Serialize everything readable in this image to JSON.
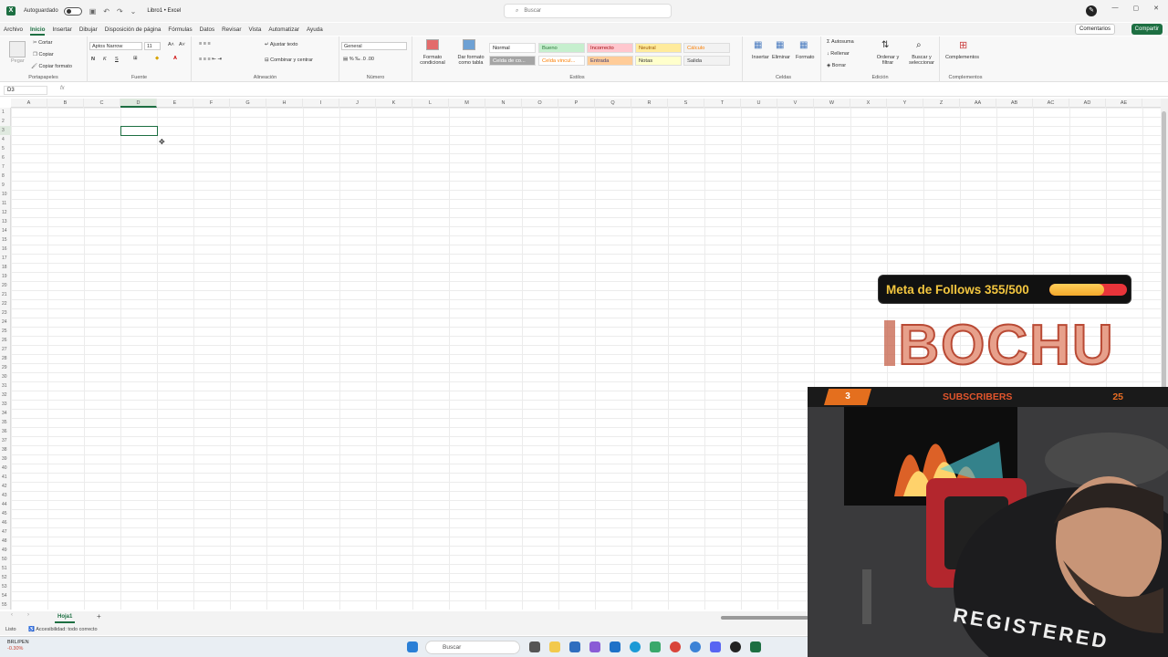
{
  "titlebar": {
    "autosave_label": "Autoguardado",
    "doc_title": "Libro1 • Excel",
    "search_placeholder": "Buscar"
  },
  "menu": {
    "tabs": [
      "Archivo",
      "Inicio",
      "Insertar",
      "Dibujar",
      "Disposición de página",
      "Fórmulas",
      "Datos",
      "Revisar",
      "Vista",
      "Automatizar",
      "Ayuda"
    ],
    "active_tab": "Inicio",
    "comments": "Comentarios",
    "share": "Compartir"
  },
  "ribbon": {
    "clipboard": {
      "paste": "Pegar",
      "cut": "Cortar",
      "copy": "Copiar",
      "format_painter": "Copiar formato",
      "label": "Portapapeles"
    },
    "font": {
      "name": "Aptos Narrow",
      "size": "11",
      "bold": "N",
      "italic": "K",
      "underline": "S",
      "label": "Fuente"
    },
    "alignment": {
      "wrap": "Ajustar texto",
      "merge": "Combinar y centrar",
      "label": "Alineación"
    },
    "number": {
      "format": "General",
      "label": "Número"
    },
    "styles": {
      "conditional": "Formato condicional",
      "as_table": "Dar formato como tabla",
      "cells": [
        {
          "text": "Normal",
          "bg": "#ffffff",
          "fg": "#222222"
        },
        {
          "text": "Bueno",
          "bg": "#c6efce",
          "fg": "#2c7a3b"
        },
        {
          "text": "Incorrecto",
          "bg": "#ffc7ce",
          "fg": "#9c0006"
        },
        {
          "text": "Neutral",
          "bg": "#ffeb9c",
          "fg": "#9c5700"
        },
        {
          "text": "Cálculo",
          "bg": "#f2f2f2",
          "fg": "#fa7d00"
        },
        {
          "text": "Celda de co...",
          "bg": "#a5a5a5",
          "fg": "#ffffff"
        },
        {
          "text": "Celda vincul...",
          "bg": "#ffffff",
          "fg": "#fa7d00"
        },
        {
          "text": "Entrada",
          "bg": "#ffcc99",
          "fg": "#3f3f76"
        },
        {
          "text": "Notas",
          "bg": "#ffffcc",
          "fg": "#333333"
        },
        {
          "text": "Salida",
          "bg": "#f2f2f2",
          "fg": "#3f3f3f"
        }
      ],
      "label": "Estilos"
    },
    "cells_group": {
      "insert": "Insertar",
      "delete": "Eliminar",
      "format": "Formato",
      "label": "Celdas"
    },
    "editing": {
      "autosum": "Autosuma",
      "fill": "Rellenar",
      "clear": "Borrar",
      "sort": "Ordenar y filtrar",
      "find": "Buscar y seleccionar",
      "label": "Edición"
    },
    "addins": {
      "button": "Complementos",
      "label": "Complementos"
    }
  },
  "formula_bar": {
    "name_box": "D3",
    "fx": "fx",
    "value": ""
  },
  "grid": {
    "columns": [
      "A",
      "B",
      "C",
      "D",
      "E",
      "F",
      "G",
      "H",
      "I",
      "J",
      "K",
      "L",
      "M",
      "N",
      "O",
      "P",
      "Q",
      "R",
      "S",
      "T",
      "U",
      "V",
      "W",
      "X",
      "Y",
      "Z",
      "AA",
      "AB",
      "AC",
      "AD",
      "AE"
    ],
    "rows": [
      "1",
      "2",
      "3",
      "4",
      "5",
      "6",
      "7",
      "8",
      "9",
      "10",
      "11",
      "12",
      "13",
      "14",
      "15",
      "16",
      "17",
      "18",
      "19",
      "20",
      "21",
      "22",
      "23",
      "24",
      "25",
      "26",
      "27",
      "28",
      "29",
      "30",
      "31",
      "32",
      "33",
      "34",
      "35",
      "36",
      "37",
      "38",
      "39",
      "40",
      "41",
      "42",
      "43",
      "44",
      "45",
      "46",
      "47",
      "48",
      "49",
      "50",
      "51",
      "52",
      "53",
      "54",
      "55"
    ],
    "selected_cell": "D3"
  },
  "sheets": {
    "tabs": [
      "Hoja1"
    ],
    "add": "+"
  },
  "status": {
    "ready": "Listo",
    "accessibility": "Accesibilidad: todo correcto"
  },
  "taskbar": {
    "stock_name": "BRL/PEN",
    "stock_change": "-0.30%",
    "search": "Buscar"
  },
  "overlay": {
    "follow_goal_text": "Meta de Follows 355/500",
    "follow_progress": 0.71,
    "logo_text": "BOCHU",
    "sub_left": "3",
    "sub_title": "SUBSCRIBERS",
    "sub_right": "25",
    "shirt_text": "REGISTERED"
  }
}
